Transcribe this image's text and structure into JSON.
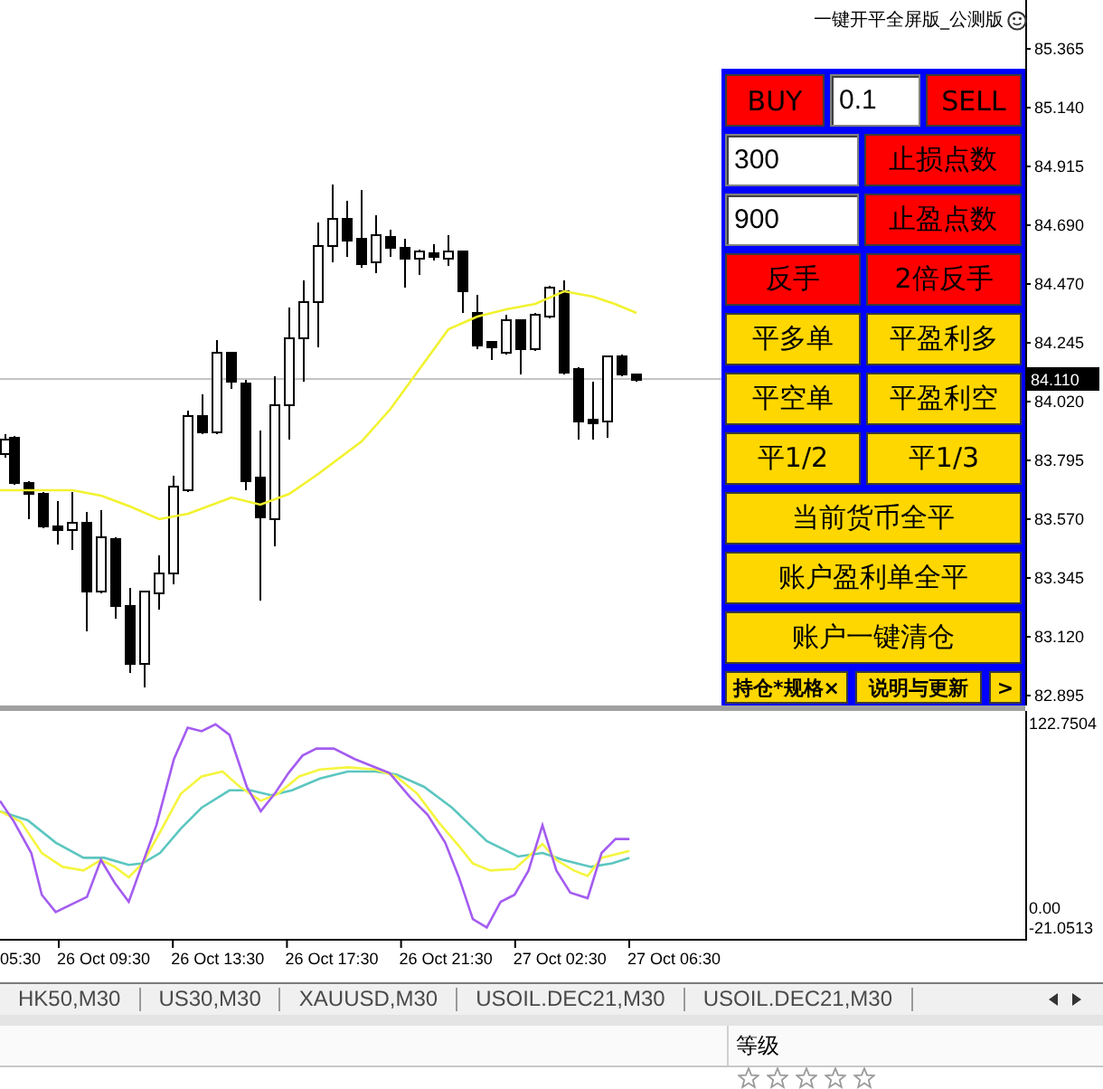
{
  "chart": {
    "title": "一键开平全屏版_公测版",
    "price_labels": [
      "85.365",
      "85.140",
      "84.915",
      "84.690",
      "84.470",
      "84.245",
      "84.020",
      "83.795",
      "83.570",
      "83.345",
      "83.120",
      "82.895"
    ],
    "current_price": "84.110"
  },
  "panel": {
    "rows": [
      {
        "items": [
          {
            "kind": "button",
            "label": "BUY",
            "color": "#ff0000"
          },
          {
            "kind": "field",
            "value": "0.1"
          },
          {
            "kind": "button",
            "label": "SELL",
            "color": "#ff0000"
          }
        ]
      },
      {
        "items": [
          {
            "kind": "field",
            "value": "300"
          },
          {
            "kind": "button",
            "label": "止损点数",
            "color": "#ff0000"
          }
        ]
      },
      {
        "items": [
          {
            "kind": "field",
            "value": "900"
          },
          {
            "kind": "button",
            "label": "止盈点数",
            "color": "#ff0000"
          }
        ]
      },
      {
        "items": [
          {
            "kind": "button",
            "label": "反手",
            "color": "#ff0000"
          },
          {
            "kind": "button",
            "label": "2倍反手",
            "color": "#ff0000"
          }
        ]
      },
      {
        "items": [
          {
            "kind": "button",
            "label": "平多单",
            "color": "#ffd700"
          },
          {
            "kind": "button",
            "label": "平盈利多",
            "color": "#ffd700"
          }
        ]
      },
      {
        "items": [
          {
            "kind": "button",
            "label": "平空单",
            "color": "#ffd700"
          },
          {
            "kind": "button",
            "label": "平盈利空",
            "color": "#ffd700"
          }
        ]
      },
      {
        "items": [
          {
            "kind": "button",
            "label": "平1/2",
            "color": "#ffd700"
          },
          {
            "kind": "button",
            "label": "平1/3",
            "color": "#ffd700"
          }
        ]
      },
      {
        "items": [
          {
            "kind": "button",
            "label": "当前货币全平",
            "color": "#ffd700"
          }
        ]
      },
      {
        "items": [
          {
            "kind": "button",
            "label": "账户盈利单全平",
            "color": "#ffd700"
          }
        ]
      },
      {
        "items": [
          {
            "kind": "button",
            "label": "账户一键清仓",
            "color": "#ffd700"
          }
        ]
      },
      {
        "items": [
          {
            "kind": "button",
            "label": "持仓*规格×",
            "color": "#ffd700"
          },
          {
            "kind": "button",
            "label": "说明与更新",
            "color": "#ffd700"
          },
          {
            "kind": "button",
            "label": ">",
            "color": "#ffd700"
          }
        ]
      }
    ]
  },
  "indicator": {
    "axis_labels": [
      "122.7504",
      "0.00",
      "-21.0513"
    ]
  },
  "time_axis": {
    "labels": [
      "05:30",
      "26 Oct 09:30",
      "26 Oct 13:30",
      "26 Oct 17:30",
      "26 Oct 21:30",
      "27 Oct 02:30",
      "27 Oct 06:30"
    ]
  },
  "tabs": [
    {
      "label": "HK50,M30",
      "selected": false
    },
    {
      "label": "US30,M30",
      "selected": false
    },
    {
      "label": "XAUUSD,M30",
      "selected": false
    },
    {
      "label": "USOIL.DEC21,M30",
      "selected": false
    },
    {
      "label": "USOIL.DEC21,M30",
      "selected": false
    }
  ],
  "table": {
    "columns": [
      "等级"
    ],
    "rows": [
      {
        "stars": 0
      }
    ]
  }
}
